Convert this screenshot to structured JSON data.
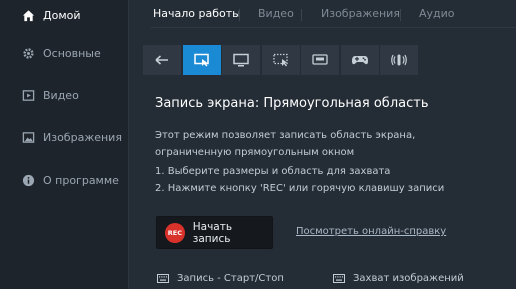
{
  "sidebar": {
    "items": [
      {
        "label": "Домой",
        "icon": "home-icon"
      },
      {
        "label": "Основные",
        "icon": "gear-icon"
      },
      {
        "label": "Видео",
        "icon": "video-icon"
      },
      {
        "label": "Изображения",
        "icon": "image-icon"
      },
      {
        "label": "О программе",
        "icon": "info-icon"
      }
    ]
  },
  "tabs": [
    {
      "label": "Начало работы"
    },
    {
      "label": "Видео"
    },
    {
      "label": "Изображения"
    },
    {
      "label": "Аудио"
    }
  ],
  "toolbar": {
    "tools": [
      {
        "icon": "back-arrow-icon"
      },
      {
        "icon": "rectangle-area-icon"
      },
      {
        "icon": "monitor-icon"
      },
      {
        "icon": "region-select-icon"
      },
      {
        "icon": "hdmi-device-icon"
      },
      {
        "icon": "gamepad-icon"
      },
      {
        "icon": "audio-icon"
      }
    ]
  },
  "content": {
    "title": "Запись экрана: Прямоугольная область",
    "description": "Этот режим позволяет записать область экрана, ограниченную прямоугольным окном",
    "step1": "1. Выберите размеры и область для захвата",
    "step2": "2. Нажмите кнопку 'REC' или горячую клавишу записи",
    "rec_badge": "REC",
    "rec_label": "Начать запись",
    "help_link": "Посмотреть онлайн-справку"
  },
  "hotkeys": {
    "record": "Запись - Старт/Стоп",
    "capture": "Захват изображений"
  },
  "colors": {
    "accent": "#1a8ad4",
    "rec_red": "#d8322b"
  }
}
